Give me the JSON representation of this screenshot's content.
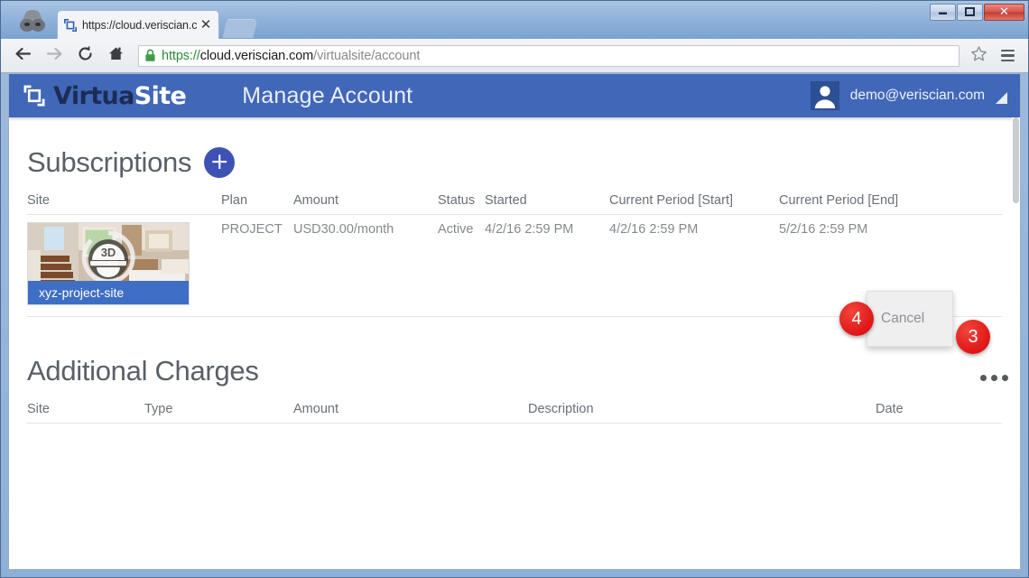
{
  "browser": {
    "tab": {
      "title": "https://cloud.veriscian.con",
      "close_label": "✕",
      "favicon": "virtualsite-favicon"
    },
    "window_controls": {
      "minimize": "–",
      "maximize": "□",
      "close": "✕"
    },
    "toolbar": {
      "back": "back-arrow",
      "forward": "forward-arrow",
      "reload": "reload-arrow",
      "home": "home-house",
      "bookmark": "star-outline",
      "menu": "hamburger"
    },
    "address_bar": {
      "scheme": "https://",
      "host": "cloud.veriscian.com",
      "path": "/virtualsite/account",
      "full_url": "https://cloud.veriscian.com/virtualsite/account",
      "secure_icon": "green-padlock"
    }
  },
  "app": {
    "logo": {
      "part1": "Virtua",
      "part2": "Site"
    },
    "title": "Manage Account",
    "user": {
      "email": "demo@veriscian.com",
      "avatar_icon": "user-avatar-icon",
      "menu_caret": "triangle-down"
    }
  },
  "subscriptions": {
    "heading": "Subscriptions",
    "add_label": "+",
    "columns": [
      "Site",
      "Plan",
      "Amount",
      "Status",
      "Started",
      "Current Period [Start]",
      "Current Period [End]"
    ],
    "rows": [
      {
        "site_name": "xyz-project-site",
        "site_badge": "3D",
        "plan": "PROJECT",
        "amount": "USD30.00/month",
        "status": "Active",
        "started": "4/2/16 2:59 PM",
        "period_start": "4/2/16 2:59 PM",
        "period_end": "5/2/16 2:59 PM"
      }
    ],
    "row_menu_icon": "ellipsis-icon",
    "dropdown": {
      "items": [
        "Cancel"
      ]
    }
  },
  "additional_charges": {
    "heading": "Additional Charges",
    "columns": [
      "Site",
      "Type",
      "Amount",
      "Description",
      "Date"
    ],
    "rows": []
  },
  "annotations": [
    {
      "id": "3",
      "label": "3"
    },
    {
      "id": "4",
      "label": "4"
    }
  ],
  "colors": {
    "app_bar": "#4067b8",
    "accent": "#3f51b5",
    "site_label": "#3f6fc4",
    "marker": "#e11b1b",
    "secure": "#2d8a36"
  }
}
